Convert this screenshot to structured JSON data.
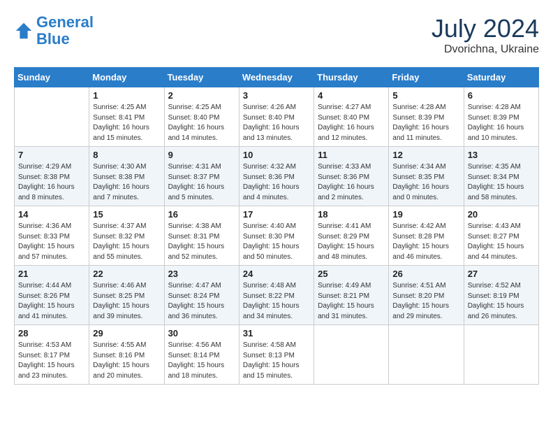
{
  "header": {
    "logo_line1": "General",
    "logo_line2": "Blue",
    "month": "July 2024",
    "location": "Dvorichna, Ukraine"
  },
  "weekdays": [
    "Sunday",
    "Monday",
    "Tuesday",
    "Wednesday",
    "Thursday",
    "Friday",
    "Saturday"
  ],
  "weeks": [
    [
      {
        "day": "",
        "info": ""
      },
      {
        "day": "1",
        "info": "Sunrise: 4:25 AM\nSunset: 8:41 PM\nDaylight: 16 hours\nand 15 minutes."
      },
      {
        "day": "2",
        "info": "Sunrise: 4:25 AM\nSunset: 8:40 PM\nDaylight: 16 hours\nand 14 minutes."
      },
      {
        "day": "3",
        "info": "Sunrise: 4:26 AM\nSunset: 8:40 PM\nDaylight: 16 hours\nand 13 minutes."
      },
      {
        "day": "4",
        "info": "Sunrise: 4:27 AM\nSunset: 8:40 PM\nDaylight: 16 hours\nand 12 minutes."
      },
      {
        "day": "5",
        "info": "Sunrise: 4:28 AM\nSunset: 8:39 PM\nDaylight: 16 hours\nand 11 minutes."
      },
      {
        "day": "6",
        "info": "Sunrise: 4:28 AM\nSunset: 8:39 PM\nDaylight: 16 hours\nand 10 minutes."
      }
    ],
    [
      {
        "day": "7",
        "info": "Sunrise: 4:29 AM\nSunset: 8:38 PM\nDaylight: 16 hours\nand 8 minutes."
      },
      {
        "day": "8",
        "info": "Sunrise: 4:30 AM\nSunset: 8:38 PM\nDaylight: 16 hours\nand 7 minutes."
      },
      {
        "day": "9",
        "info": "Sunrise: 4:31 AM\nSunset: 8:37 PM\nDaylight: 16 hours\nand 5 minutes."
      },
      {
        "day": "10",
        "info": "Sunrise: 4:32 AM\nSunset: 8:36 PM\nDaylight: 16 hours\nand 4 minutes."
      },
      {
        "day": "11",
        "info": "Sunrise: 4:33 AM\nSunset: 8:36 PM\nDaylight: 16 hours\nand 2 minutes."
      },
      {
        "day": "12",
        "info": "Sunrise: 4:34 AM\nSunset: 8:35 PM\nDaylight: 16 hours\nand 0 minutes."
      },
      {
        "day": "13",
        "info": "Sunrise: 4:35 AM\nSunset: 8:34 PM\nDaylight: 15 hours\nand 58 minutes."
      }
    ],
    [
      {
        "day": "14",
        "info": "Sunrise: 4:36 AM\nSunset: 8:33 PM\nDaylight: 15 hours\nand 57 minutes."
      },
      {
        "day": "15",
        "info": "Sunrise: 4:37 AM\nSunset: 8:32 PM\nDaylight: 15 hours\nand 55 minutes."
      },
      {
        "day": "16",
        "info": "Sunrise: 4:38 AM\nSunset: 8:31 PM\nDaylight: 15 hours\nand 52 minutes."
      },
      {
        "day": "17",
        "info": "Sunrise: 4:40 AM\nSunset: 8:30 PM\nDaylight: 15 hours\nand 50 minutes."
      },
      {
        "day": "18",
        "info": "Sunrise: 4:41 AM\nSunset: 8:29 PM\nDaylight: 15 hours\nand 48 minutes."
      },
      {
        "day": "19",
        "info": "Sunrise: 4:42 AM\nSunset: 8:28 PM\nDaylight: 15 hours\nand 46 minutes."
      },
      {
        "day": "20",
        "info": "Sunrise: 4:43 AM\nSunset: 8:27 PM\nDaylight: 15 hours\nand 44 minutes."
      }
    ],
    [
      {
        "day": "21",
        "info": "Sunrise: 4:44 AM\nSunset: 8:26 PM\nDaylight: 15 hours\nand 41 minutes."
      },
      {
        "day": "22",
        "info": "Sunrise: 4:46 AM\nSunset: 8:25 PM\nDaylight: 15 hours\nand 39 minutes."
      },
      {
        "day": "23",
        "info": "Sunrise: 4:47 AM\nSunset: 8:24 PM\nDaylight: 15 hours\nand 36 minutes."
      },
      {
        "day": "24",
        "info": "Sunrise: 4:48 AM\nSunset: 8:22 PM\nDaylight: 15 hours\nand 34 minutes."
      },
      {
        "day": "25",
        "info": "Sunrise: 4:49 AM\nSunset: 8:21 PM\nDaylight: 15 hours\nand 31 minutes."
      },
      {
        "day": "26",
        "info": "Sunrise: 4:51 AM\nSunset: 8:20 PM\nDaylight: 15 hours\nand 29 minutes."
      },
      {
        "day": "27",
        "info": "Sunrise: 4:52 AM\nSunset: 8:19 PM\nDaylight: 15 hours\nand 26 minutes."
      }
    ],
    [
      {
        "day": "28",
        "info": "Sunrise: 4:53 AM\nSunset: 8:17 PM\nDaylight: 15 hours\nand 23 minutes."
      },
      {
        "day": "29",
        "info": "Sunrise: 4:55 AM\nSunset: 8:16 PM\nDaylight: 15 hours\nand 20 minutes."
      },
      {
        "day": "30",
        "info": "Sunrise: 4:56 AM\nSunset: 8:14 PM\nDaylight: 15 hours\nand 18 minutes."
      },
      {
        "day": "31",
        "info": "Sunrise: 4:58 AM\nSunset: 8:13 PM\nDaylight: 15 hours\nand 15 minutes."
      },
      {
        "day": "",
        "info": ""
      },
      {
        "day": "",
        "info": ""
      },
      {
        "day": "",
        "info": ""
      }
    ]
  ]
}
